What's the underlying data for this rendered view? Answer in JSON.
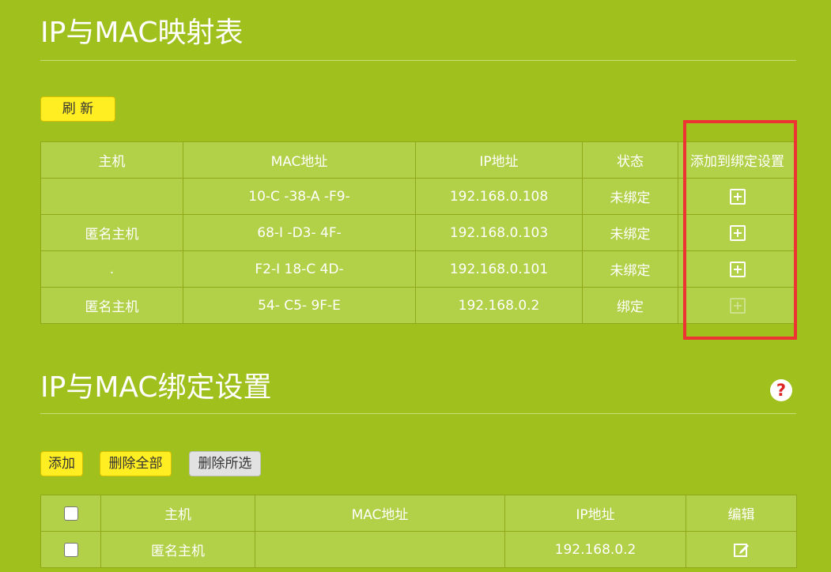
{
  "mapping_section": {
    "title": "IP与MAC映射表",
    "refresh_label": "刷 新",
    "columns": [
      "主机",
      "MAC地址",
      "IP地址",
      "状态",
      "添加到绑定设置"
    ],
    "rows": [
      {
        "host": "",
        "mac": "10-C  -38-A  -F9-",
        "ip": "192.168.0.108",
        "status": "未绑定",
        "add_enabled": true
      },
      {
        "host": "匿名主机",
        "mac": "68-I  -D3-  4F-",
        "ip": "192.168.0.103",
        "status": "未绑定",
        "add_enabled": true
      },
      {
        "host": ".",
        "mac": "F2-I  18-C  4D-",
        "ip": "192.168.0.101",
        "status": "未绑定",
        "add_enabled": true
      },
      {
        "host": "匿名主机",
        "mac": "54-  C5-  9F-E",
        "ip": "192.168.0.2",
        "status": "绑定",
        "add_enabled": false
      }
    ]
  },
  "binding_section": {
    "title": "IP与MAC绑定设置",
    "help_label": "?",
    "add_label": "添加",
    "delete_all_label": "删除全部",
    "delete_selected_label": "删除所选",
    "columns": [
      "主机",
      "MAC地址",
      "IP地址",
      "编辑"
    ],
    "rows": [
      {
        "host": "匿名主机",
        "mac": "",
        "ip": "192.168.0.2"
      }
    ]
  },
  "colors": {
    "background": "#a0c01e",
    "button_yellow": "#ffee22",
    "highlight_red": "#ee3333"
  }
}
